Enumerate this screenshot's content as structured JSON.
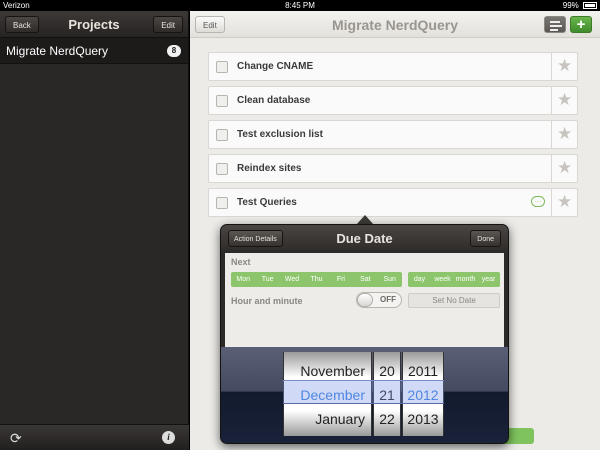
{
  "status_bar": {
    "carrier": "Verizon",
    "time": "8:45 PM",
    "battery": "99%"
  },
  "sidebar": {
    "back_label": "Back",
    "title": "Projects",
    "edit_label": "Edit",
    "items": [
      {
        "label": "Migrate NerdQuery",
        "count": "8"
      }
    ]
  },
  "main": {
    "edit_label": "Edit",
    "title": "Migrate NerdQuery",
    "tasks": [
      {
        "label": "Change CNAME"
      },
      {
        "label": "Clean database"
      },
      {
        "label": "Test exclusion list"
      },
      {
        "label": "Reindex sites"
      },
      {
        "label": "Test Queries"
      }
    ]
  },
  "popover": {
    "back_label": "Action Details",
    "title": "Due Date",
    "done_label": "Done",
    "next_label": "Next",
    "days": [
      "Mon",
      "Tue",
      "Wed",
      "Thu",
      "Fri",
      "Sat",
      "Sun"
    ],
    "units": [
      "day",
      "week",
      "month",
      "year"
    ],
    "hour_minute_label": "Hour and minute",
    "toggle_state": "OFF",
    "no_date_label": "Set No Date",
    "picker": {
      "months": [
        "November",
        "December",
        "January"
      ],
      "days": [
        "20",
        "21",
        "22"
      ],
      "years": [
        "2011",
        "2012",
        "2013"
      ]
    }
  },
  "colors": {
    "accent_green": "#8cc56c",
    "selected_blue": "#3b7de0"
  }
}
